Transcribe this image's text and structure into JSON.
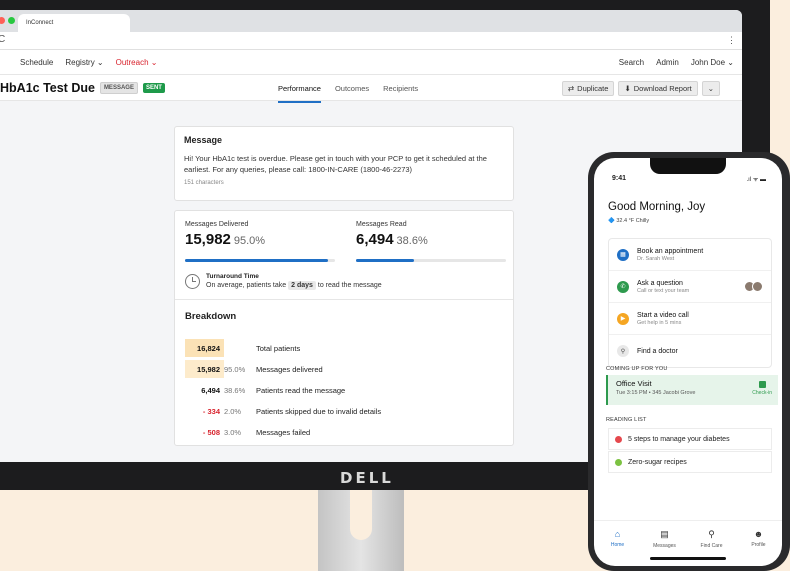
{
  "browser": {
    "tab_title": "InConnect",
    "reload_glyph": "C",
    "menu_glyph": "⋮",
    "dot_colors": [
      "#ff5f57",
      "#28c840"
    ]
  },
  "nav": {
    "left": [
      {
        "label": "Schedule"
      },
      {
        "label": "Registry ⌄"
      },
      {
        "label": "Outreach ⌄",
        "active": true
      }
    ],
    "right": [
      {
        "label": "Search"
      },
      {
        "label": "Admin"
      },
      {
        "label": "John Doe ⌄"
      }
    ]
  },
  "page": {
    "title": "HbA1c Test Due",
    "badge_type": "MESSAGE",
    "badge_status": "SENT",
    "tabs": [
      "Performance",
      "Outcomes",
      "Recipients"
    ],
    "duplicate_label": "Duplicate",
    "download_label": "Download Report",
    "duplicate_icon": "⇄",
    "download_icon": "⬇",
    "more_icon": "⌄"
  },
  "message": {
    "heading": "Message",
    "body": "Hi! Your HbA1c test is overdue. Please get in touch with your PCP to get it scheduled at the earliest. For any queries, please call: 1800-IN-CARE (1800-46-2273)",
    "chars": "151 characters"
  },
  "stats": {
    "delivered_label": "Messages Delivered",
    "delivered_value": "15,982",
    "delivered_pct": "95.0%",
    "delivered_fraction": 0.95,
    "read_label": "Messages Read",
    "read_value": "6,494",
    "read_pct": "38.6%",
    "read_fraction": 0.386,
    "turnaround_title": "Turnaround Time",
    "turnaround_pre": "On average, patients take",
    "turnaround_days": "2 days",
    "turnaround_post": "to read the message"
  },
  "breakdown": {
    "title": "Breakdown",
    "rows": [
      {
        "num": "16,824",
        "pct": "",
        "desc": "Total patients",
        "style": "hl1",
        "color": "#111"
      },
      {
        "num": "15,982",
        "pct": "95.0%",
        "desc": "Messages delivered",
        "style": "hl2",
        "color": "#111"
      },
      {
        "num": "6,494",
        "pct": "38.6%",
        "desc": "Patients read the message",
        "style": "",
        "color": "#111"
      },
      {
        "num": "- 334",
        "pct": "2.0%",
        "desc": "Patients skipped due to invalid details",
        "style": "",
        "color": "#d8222c"
      },
      {
        "num": "- 508",
        "pct": "3.0%",
        "desc": "Messages failed",
        "style": "",
        "color": "#d8222c"
      }
    ]
  },
  "monitor": {
    "brand": "DELL"
  },
  "phone": {
    "time": "9:41",
    "status": ".ıl ᯤ ▬",
    "greeting": "Good Morning, Joy",
    "weather": "🔷 32.4 °F  Chilly",
    "actions": [
      {
        "title": "Book an appointment",
        "sub": "Dr. Sarah West",
        "color": "#1f6fc5",
        "glyph": "▦"
      },
      {
        "title": "Ask a question",
        "sub": "Call or text your team",
        "color": "#2e9a4e",
        "glyph": "✆"
      },
      {
        "title": "Start a video call",
        "sub": "Get help in 5 mins",
        "color": "#f5a623",
        "glyph": "▶"
      },
      {
        "title": "Find a doctor",
        "sub": "",
        "color": "#e8e8e8",
        "glyph": "⚲"
      }
    ],
    "coming_up_label": "COMING UP FOR YOU",
    "visit_title": "Office Visit",
    "visit_detail": "Tue 3:15 PM  •  345 Jacobi Grove",
    "checkin_label": "Check-in",
    "reading_label": "READING LIST",
    "reading": [
      {
        "title": "5 steps to manage your diabetes",
        "color": "#e5484d"
      },
      {
        "title": "Zero-sugar recipes",
        "color": "#7cc242"
      }
    ],
    "tabs": [
      {
        "label": "Home",
        "glyph": "⌂",
        "on": true
      },
      {
        "label": "Messages",
        "glyph": "▤",
        "on": false
      },
      {
        "label": "Find Care",
        "glyph": "⚲",
        "on": false
      },
      {
        "label": "Profile",
        "glyph": "☻",
        "on": false
      }
    ]
  }
}
